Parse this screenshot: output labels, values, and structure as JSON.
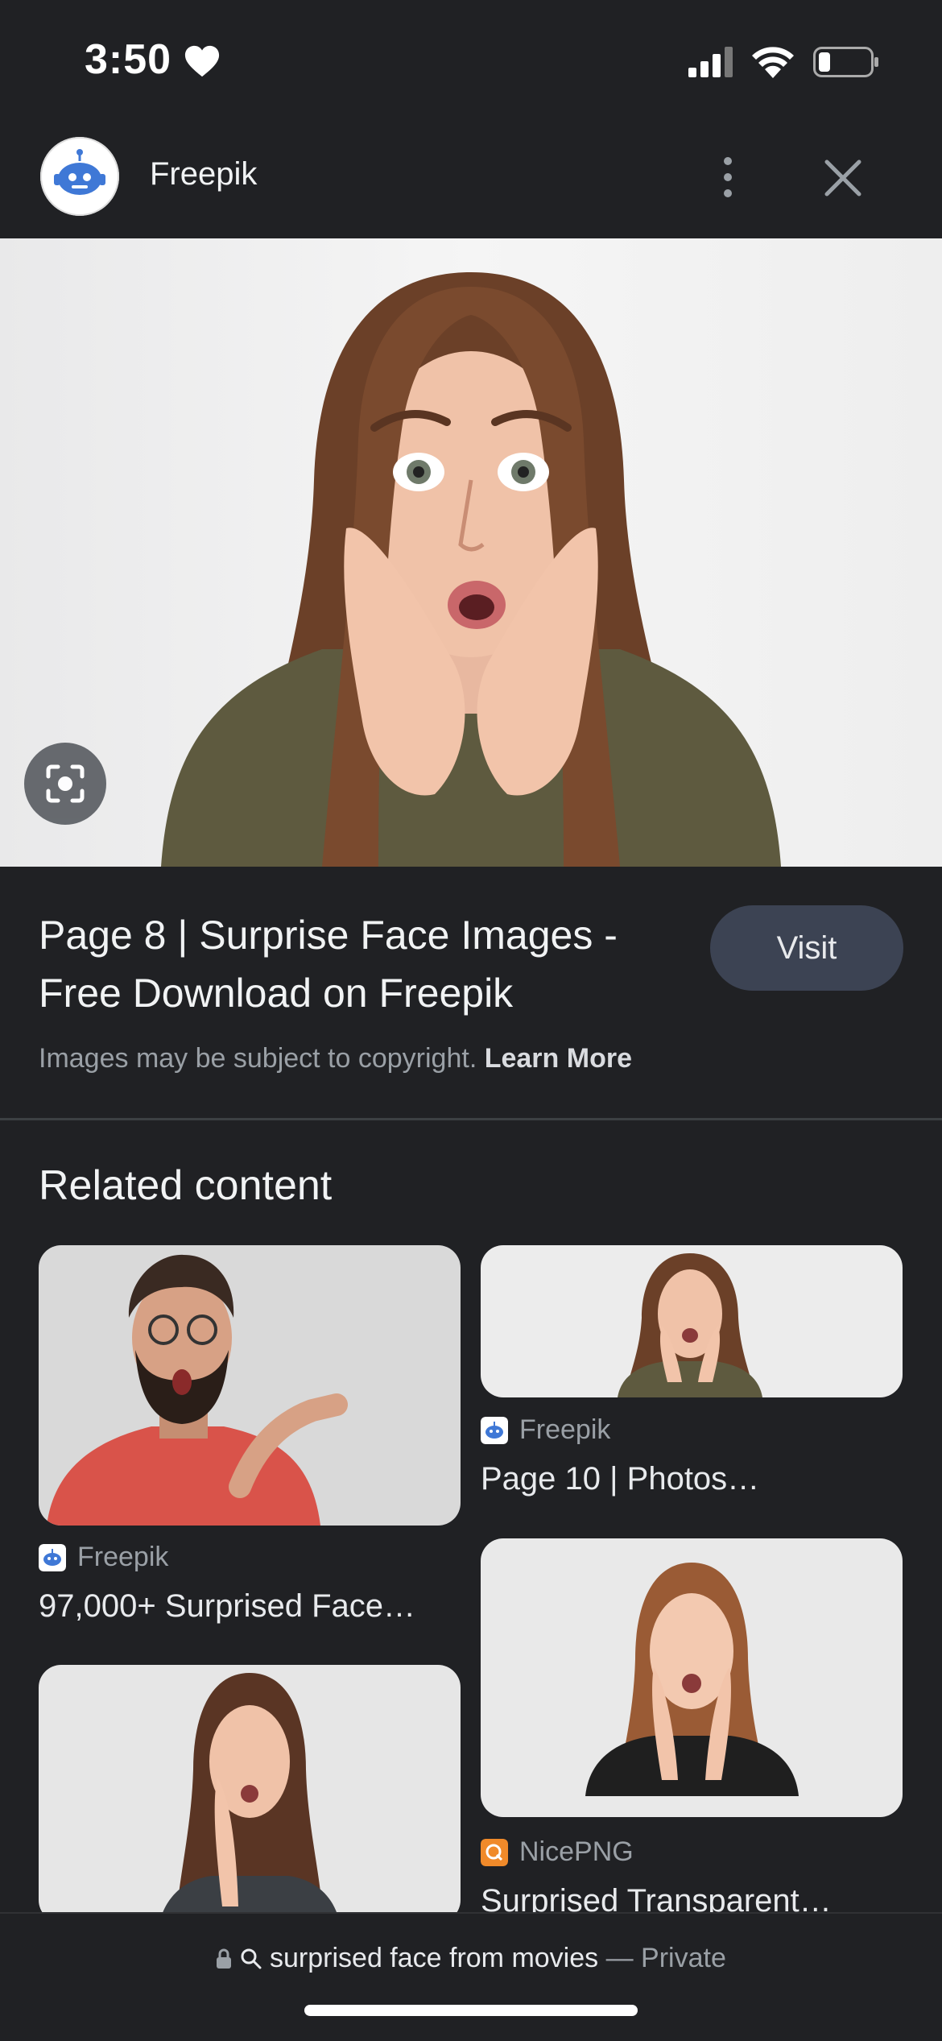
{
  "status": {
    "time": "3:50"
  },
  "header": {
    "site_name": "Freepik"
  },
  "result": {
    "title_line1": "Page 8 | Surprise Face Images -",
    "title_line2": "Free Download on Freepik",
    "visit_label": "Visit",
    "copyright_text": "Images may be subject to copyright.",
    "learn_more": "Learn More"
  },
  "related": {
    "heading": "Related content",
    "items": [
      {
        "source": "Freepik",
        "title": "97,000+ Surprised Face…"
      },
      {
        "source": "Freepik",
        "title": "Page 10 | Photos…"
      },
      {
        "source": "NicePNG",
        "title": "Surprised Transparent…"
      },
      {
        "source": "",
        "title": ""
      }
    ]
  },
  "bottom": {
    "query": "surprised face from movies",
    "mode": "— Private"
  },
  "icons": {
    "favicon_freepik": "robot-icon",
    "favicon_nicepng": "q-icon"
  },
  "colors": {
    "background": "#202124",
    "visit_button": "#3c4353",
    "muted_text": "#9aa0a6"
  }
}
